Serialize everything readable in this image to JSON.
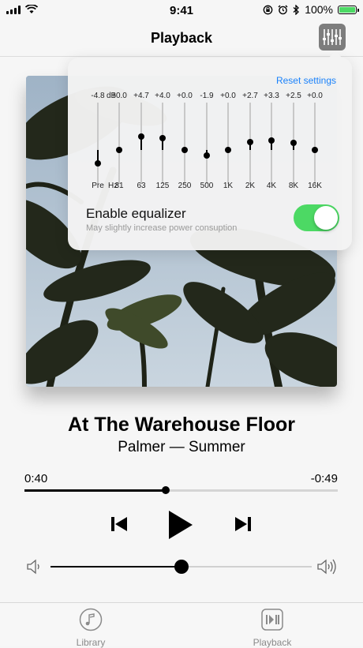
{
  "status_bar": {
    "time": "9:41",
    "battery": "100%"
  },
  "nav": {
    "title": "Playback"
  },
  "equalizer": {
    "reset_label": "Reset settings",
    "unit_label": "dB",
    "hz_label": "Hz",
    "bands": [
      {
        "label": "Pre",
        "value": "-4.8",
        "gain": -4.8
      },
      {
        "label": "31",
        "value": "+0.0",
        "gain": 0.0
      },
      {
        "label": "63",
        "value": "+4.7",
        "gain": 4.7
      },
      {
        "label": "125",
        "value": "+4.0",
        "gain": 4.0
      },
      {
        "label": "250",
        "value": "+0.0",
        "gain": 0.0
      },
      {
        "label": "500",
        "value": "-1.9",
        "gain": -1.9
      },
      {
        "label": "1K",
        "value": "+0.0",
        "gain": 0.0
      },
      {
        "label": "2K",
        "value": "+2.7",
        "gain": 2.7
      },
      {
        "label": "4K",
        "value": "+3.3",
        "gain": 3.3
      },
      {
        "label": "8K",
        "value": "+2.5",
        "gain": 2.5
      },
      {
        "label": "16K",
        "value": "+0.0",
        "gain": 0.0
      }
    ],
    "enable_label": "Enable equalizer",
    "enable_sub": "May slightly increase power consuption",
    "enabled": true
  },
  "track": {
    "title": "At The Warehouse Floor",
    "subtitle": "Palmer — Summer",
    "elapsed": "0:40",
    "remaining": "-0:49",
    "progress_fraction": 0.45
  },
  "volume": {
    "level_fraction": 0.5
  },
  "tabs": [
    {
      "label": "Library",
      "icon": "music-note-icon"
    },
    {
      "label": "Playback",
      "icon": "playback-icon"
    }
  ],
  "colors": {
    "accent_green": "#4cd964",
    "link_blue": "#1a82fb"
  }
}
